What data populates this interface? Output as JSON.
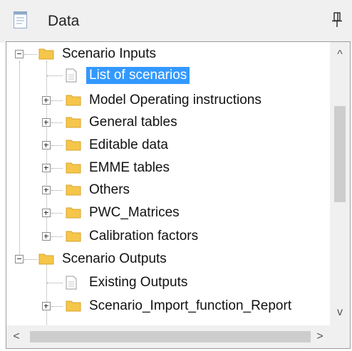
{
  "panel": {
    "title": "Data",
    "icons": {
      "header": "document-icon",
      "pin": "pin-icon"
    }
  },
  "tree": {
    "items": [
      {
        "label": "Scenario Inputs",
        "type": "folder",
        "state": "expanded"
      },
      {
        "label": "List of scenarios",
        "type": "file",
        "selected": true
      },
      {
        "label": "Model Operating instructions",
        "type": "folder",
        "state": "collapsed"
      },
      {
        "label": "General tables",
        "type": "folder",
        "state": "collapsed"
      },
      {
        "label": "Editable data",
        "type": "folder",
        "state": "collapsed"
      },
      {
        "label": "EMME tables",
        "type": "folder",
        "state": "collapsed"
      },
      {
        "label": "Others",
        "type": "folder",
        "state": "collapsed"
      },
      {
        "label": "PWC_Matrices",
        "type": "folder",
        "state": "collapsed"
      },
      {
        "label": "Calibration factors",
        "type": "folder",
        "state": "collapsed"
      },
      {
        "label": "Scenario Outputs",
        "type": "folder",
        "state": "expanded"
      },
      {
        "label": "Existing Outputs",
        "type": "file"
      },
      {
        "label": "Scenario_Import_function_Report",
        "type": "folder",
        "state": "collapsed"
      }
    ]
  },
  "scrollbars": {
    "up": "^",
    "down": "v",
    "left": "<",
    "right": ">"
  },
  "colors": {
    "selection": "#3399ff",
    "folder": "#f5c64a",
    "header_bg": "#f0f0f0"
  }
}
